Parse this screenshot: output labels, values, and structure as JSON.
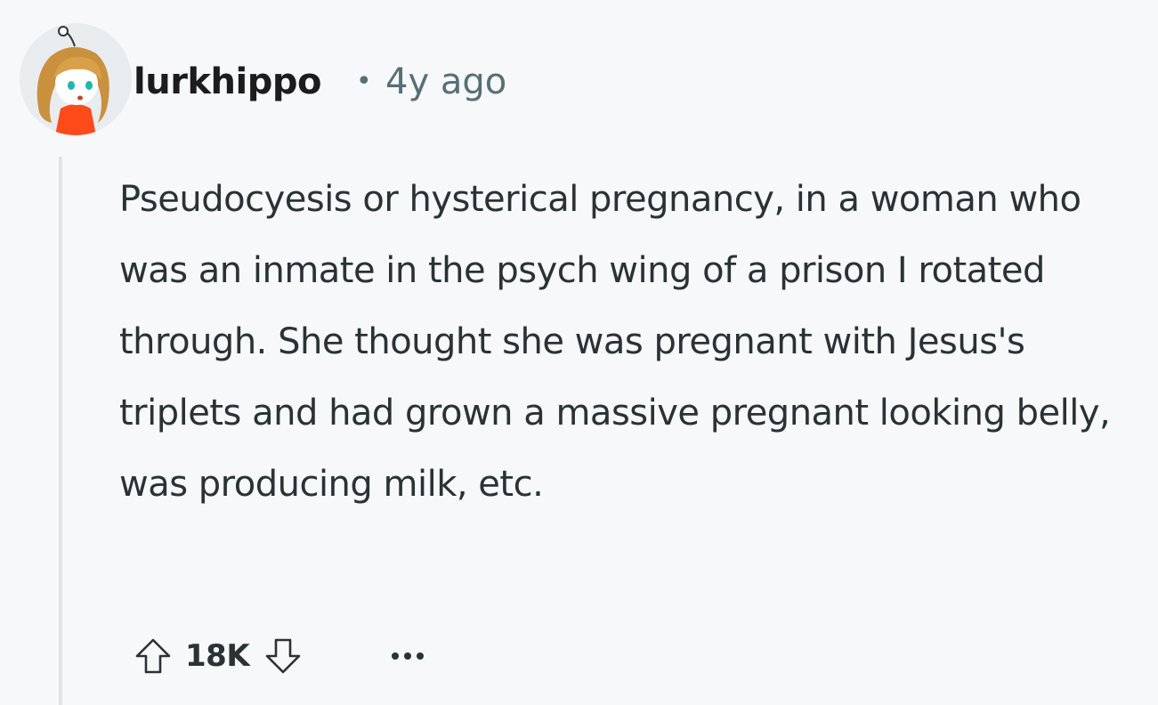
{
  "comment": {
    "author": "lurkhippo",
    "separator": "•",
    "age": "4y ago",
    "body": "Pseudocyesis or hysterical pregnancy, in a woman who was an inmate in the psych wing of a prison I rotated through. She thought she was pregnant with Jesus's triplets and had grown a massive pregnant looking belly, was producing milk, etc.",
    "score": "18K"
  },
  "icons": {
    "avatar": "snoo-avatar",
    "upvote": "arrow-up-icon",
    "downvote": "arrow-down-icon",
    "more": "more-options-icon"
  },
  "colors": {
    "background": "#f7f8fa",
    "meta_text": "#576f76",
    "thread_line": "#dfe3e6",
    "avatar_hair": "#c9903e",
    "avatar_shirt": "#ff4a1a"
  }
}
